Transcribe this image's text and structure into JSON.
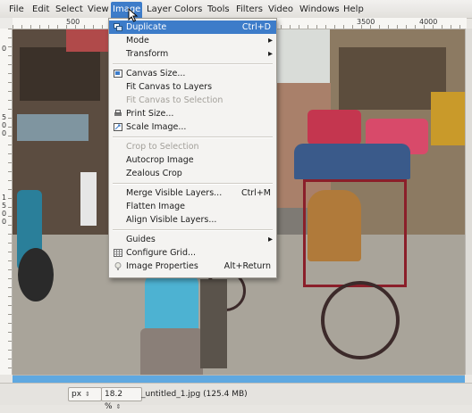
{
  "menubar": {
    "items": [
      "File",
      "Edit",
      "Select",
      "View",
      "Image",
      "Layer",
      "Colors",
      "Tools",
      "Filters",
      "Video",
      "Windows",
      "Help"
    ],
    "active": "Image"
  },
  "ruler": {
    "h_labels": [
      "500",
      "1000",
      "3500",
      "4000"
    ],
    "v_labels": [
      "0",
      "5",
      "0",
      "0",
      "1",
      "5",
      "0",
      "0"
    ]
  },
  "image_menu": {
    "items": [
      {
        "label": "Duplicate",
        "shortcut": "Ctrl+D",
        "icon": "duplicate-icon",
        "enabled": true,
        "highlighted": true
      },
      {
        "label": "Mode",
        "submenu": true,
        "enabled": true
      },
      {
        "label": "Transform",
        "submenu": true,
        "enabled": true
      },
      {
        "separator": true
      },
      {
        "label": "Canvas Size...",
        "icon": "canvas-size-icon",
        "enabled": true
      },
      {
        "label": "Fit Canvas to Layers",
        "enabled": true
      },
      {
        "label": "Fit Canvas to Selection",
        "enabled": false
      },
      {
        "label": "Print Size...",
        "icon": "print-size-icon",
        "enabled": true
      },
      {
        "label": "Scale Image...",
        "icon": "scale-image-icon",
        "enabled": true
      },
      {
        "separator": true
      },
      {
        "label": "Crop to Selection",
        "enabled": false
      },
      {
        "label": "Autocrop Image",
        "enabled": true
      },
      {
        "label": "Zealous Crop",
        "enabled": true
      },
      {
        "separator": true
      },
      {
        "label": "Merge Visible Layers...",
        "shortcut": "Ctrl+M",
        "enabled": true
      },
      {
        "label": "Flatten Image",
        "enabled": true
      },
      {
        "label": "Align Visible Layers...",
        "enabled": true
      },
      {
        "separator": true
      },
      {
        "label": "Guides",
        "submenu": true,
        "enabled": true
      },
      {
        "label": "Configure Grid...",
        "icon": "grid-icon",
        "enabled": true
      },
      {
        "label": "Image Properties",
        "shortcut": "Alt+Return",
        "icon": "info-icon",
        "enabled": true
      }
    ]
  },
  "status": {
    "unit": "px",
    "zoom": "18.2 %",
    "title": "_untitled_1.jpg (125.4 MB)"
  },
  "colors": {
    "accent": "#3d7cc9",
    "disabled_text": "#a3a09a"
  }
}
